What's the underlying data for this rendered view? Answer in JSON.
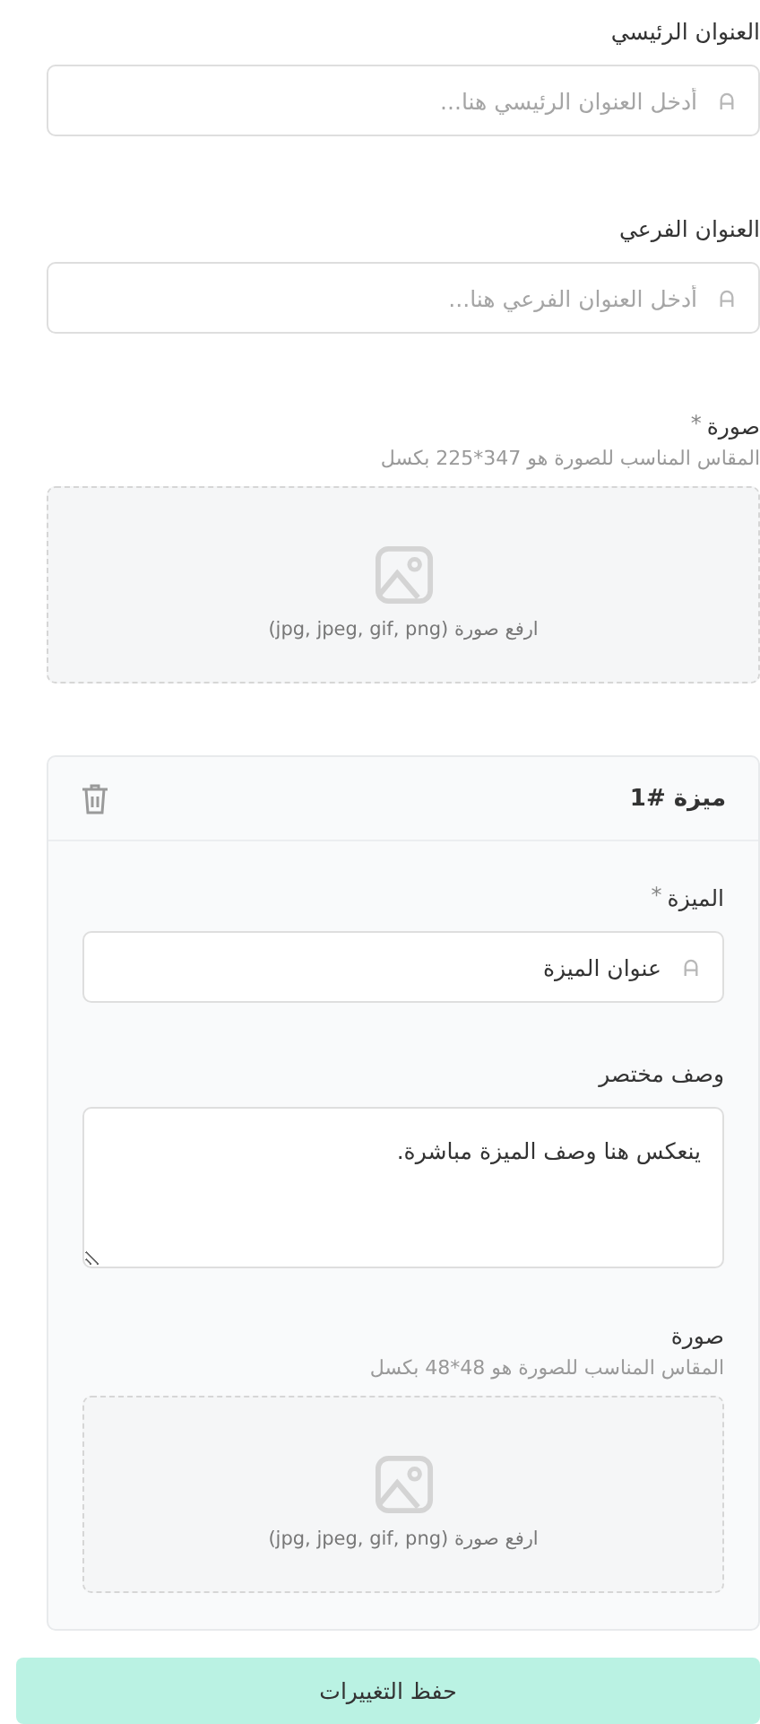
{
  "fields": [
    {
      "kind": "text",
      "label": "العنوان الرئيسي",
      "placeholder": "أدخل العنوان الرئيسي هنا..."
    },
    {
      "kind": "text",
      "label": "العنوان الفرعي",
      "placeholder": "أدخل العنوان الفرعي هنا..."
    },
    {
      "kind": "upload",
      "label": "صورة",
      "required_mark": "*",
      "hint": "المقاس المناسب للصورة هو 347*225 بكسل",
      "upload_text": "ارفع صورة (jpg, jpeg, gif, png)"
    }
  ],
  "feature_card": {
    "title": "ميزة #1",
    "fields": [
      {
        "kind": "text",
        "label": "الميزة",
        "required_mark": "*",
        "value": "عنوان الميزة"
      },
      {
        "kind": "textarea",
        "label": "وصف مختصر",
        "value": "ينعكس هنا وصف الميزة مباشرة."
      },
      {
        "kind": "upload",
        "label": "صورة",
        "hint": "المقاس المناسب للصورة هو 48*48 بكسل",
        "upload_text": "ارفع صورة (jpg, jpeg, gif, png)"
      }
    ]
  },
  "save_button": "حفظ التغييرات"
}
